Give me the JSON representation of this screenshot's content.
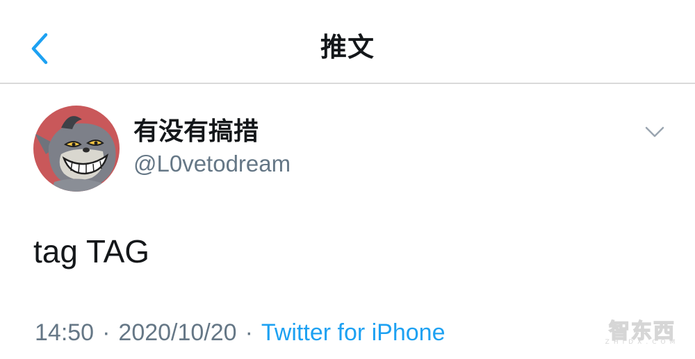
{
  "header": {
    "title": "推文",
    "back_icon": "chevron-left-icon"
  },
  "tweet": {
    "author_name": "有没有搞措",
    "author_handle": "@L0vetodream",
    "avatar_icon": "avatar-cartoon-cat",
    "more_icon": "chevron-down-icon",
    "text": "tag TAG",
    "time": "14:50",
    "separator": "·",
    "date": "2020/10/20",
    "source": "Twitter for iPhone"
  },
  "watermark": {
    "text": "智东西",
    "sub": "ZHIDX.COM"
  },
  "colors": {
    "accent": "#1da1f2",
    "secondary_text": "#657786",
    "primary_text": "#14171a",
    "divider": "#d9d9d9"
  }
}
